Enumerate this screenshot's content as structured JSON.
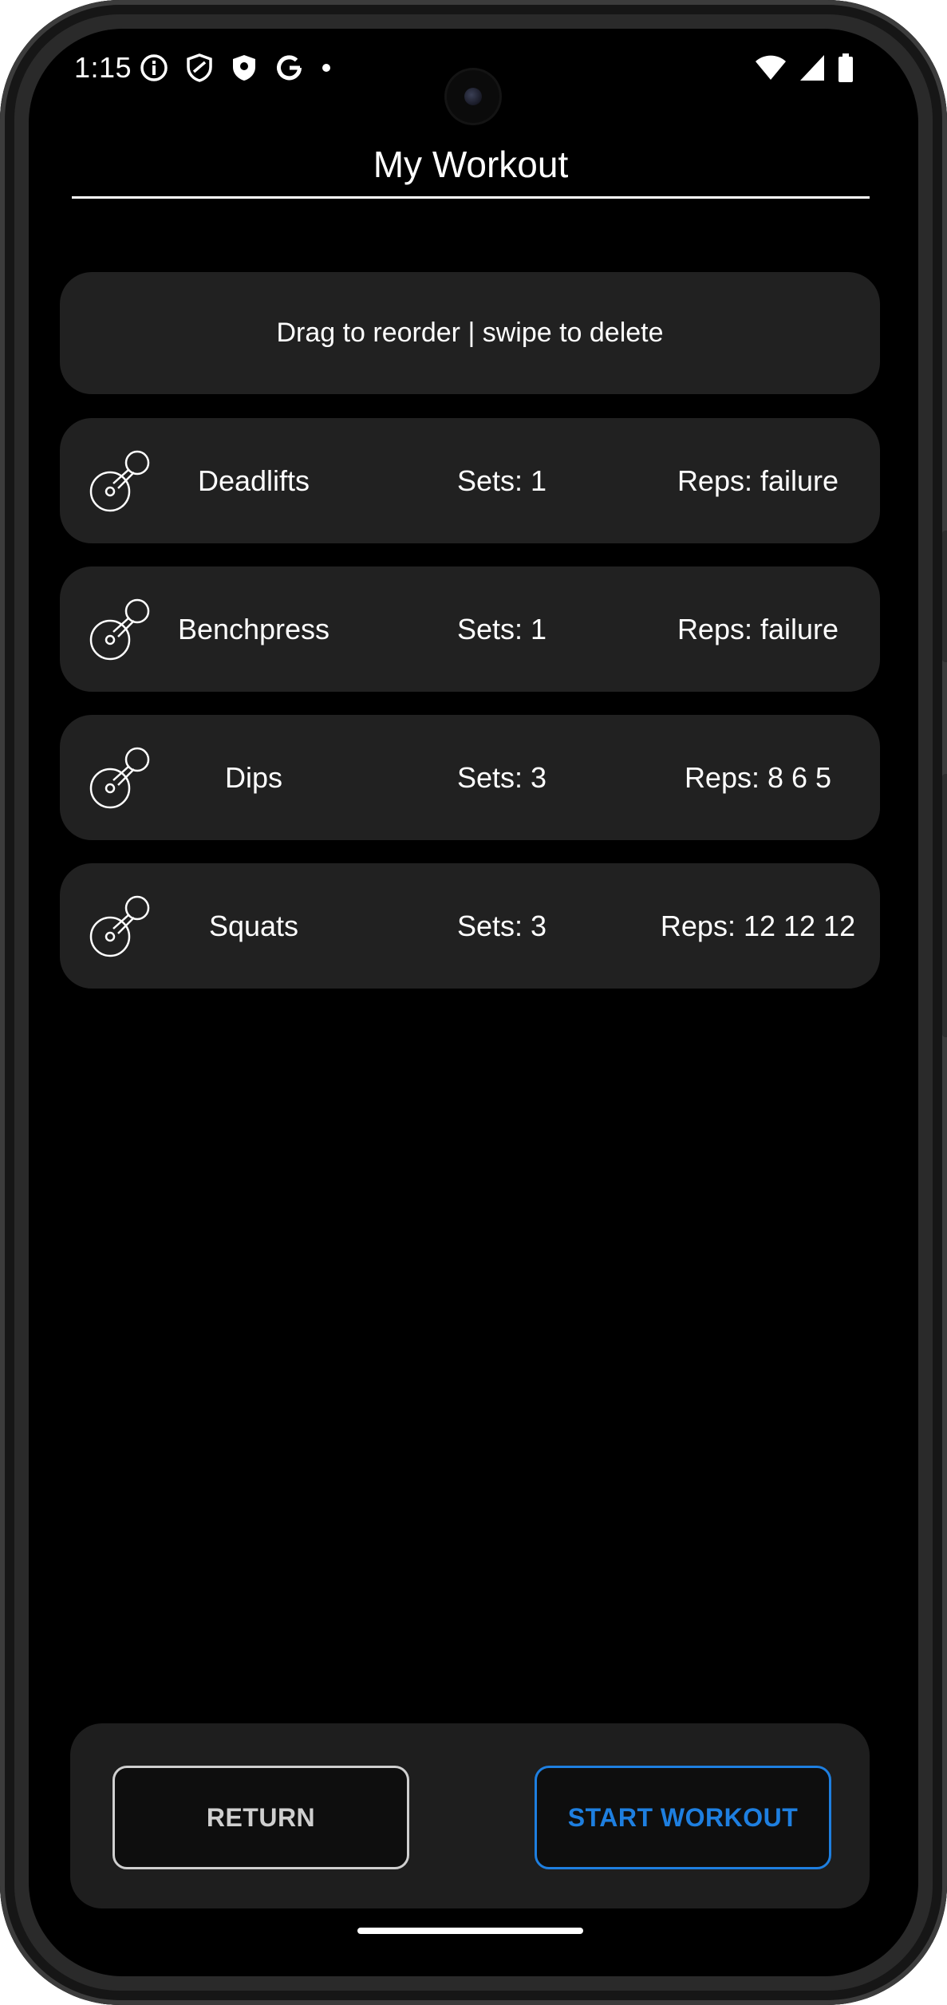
{
  "status_bar": {
    "time": "1:15",
    "left_icons": [
      "info-icon",
      "shield-outline-icon",
      "shield-filled-icon",
      "google-icon",
      "dot-icon"
    ],
    "right_icons": [
      "wifi-icon",
      "cellular-signal-icon",
      "battery-icon"
    ]
  },
  "header": {
    "title": "My Workout"
  },
  "hint": {
    "text": "Drag to reorder | swipe to delete"
  },
  "exercises": [
    {
      "icon": "dumbbell-icon",
      "name": "Deadlifts",
      "sets": "Sets: 1",
      "reps": "Reps: failure"
    },
    {
      "icon": "dumbbell-icon",
      "name": "Benchpress",
      "sets": "Sets: 1",
      "reps": "Reps: failure"
    },
    {
      "icon": "dumbbell-icon",
      "name": "Dips",
      "sets": "Sets: 3",
      "reps": "Reps: 8 6 5"
    },
    {
      "icon": "dumbbell-icon",
      "name": "Squats",
      "sets": "Sets: 3",
      "reps": "Reps: 12 12 12"
    }
  ],
  "actions": {
    "return_label": "RETURN",
    "start_label": "START WORKOUT"
  },
  "colors": {
    "background": "#000000",
    "card": "#212121",
    "accent": "#1e7fe0",
    "text": "#ffffff"
  }
}
